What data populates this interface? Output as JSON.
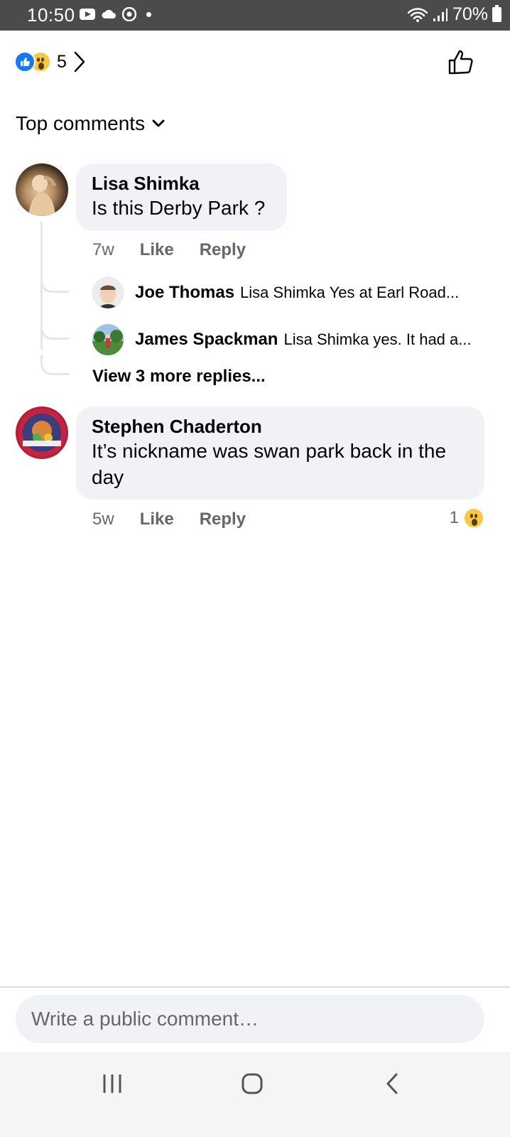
{
  "status_bar": {
    "time": "10:50",
    "battery": "70%"
  },
  "post_reactions": {
    "count": "5",
    "types": [
      "like-icon",
      "wow-icon"
    ]
  },
  "sort": {
    "label": "Top comments"
  },
  "comments": [
    {
      "author": "Lisa Shimka",
      "text": "Is this Derby Park ?",
      "age": "7w",
      "like_label": "Like",
      "reply_label": "Reply",
      "replies": [
        {
          "author": "Joe Thomas",
          "text": "Lisa Shimka Yes at Earl Road..."
        },
        {
          "author": "James Spackman",
          "text": "Lisa Shimka yes. It had a..."
        }
      ],
      "view_more": "View 3 more replies..."
    },
    {
      "author": "Stephen Chaderton",
      "text": "It’s nickname was swan park back in the day",
      "age": "5w",
      "like_label": "Like",
      "reply_label": "Reply",
      "reaction_count": "1"
    }
  ],
  "composer": {
    "placeholder": "Write a public comment…"
  },
  "colors": {
    "accent": "#1877f2",
    "bubble": "#f0f2f5",
    "muted_text": "#65676b",
    "status_bar": "#4a4b4d"
  }
}
